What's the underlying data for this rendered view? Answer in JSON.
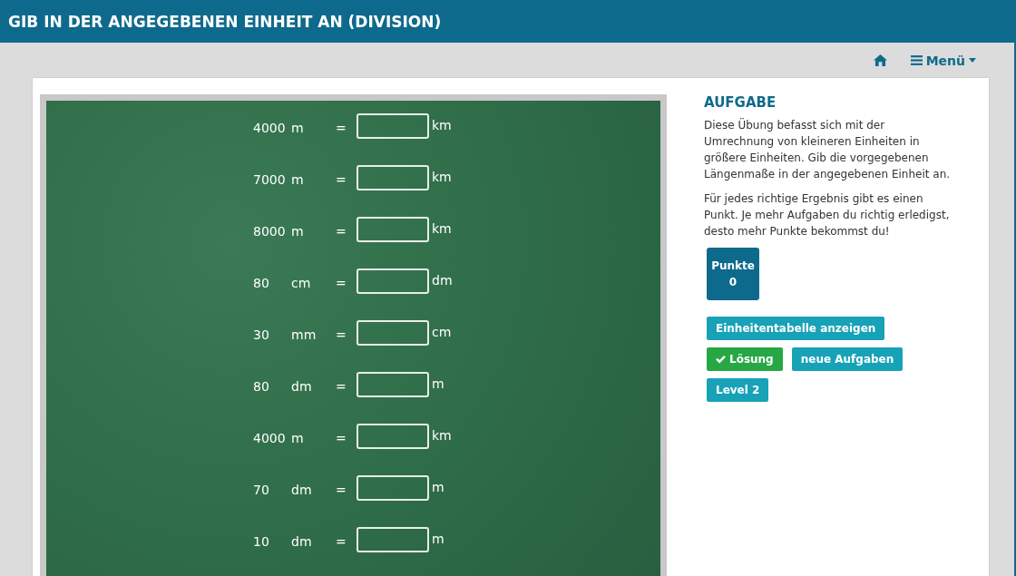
{
  "header": {
    "title": "GIB IN DER ANGEGEBENEN EINHEIT AN (DIVISION)"
  },
  "nav": {
    "menu": "Menü"
  },
  "exercises": [
    {
      "value": "4000",
      "unit": "m",
      "equals": "=",
      "target": "km"
    },
    {
      "value": "7000",
      "unit": "m",
      "equals": "=",
      "target": "km"
    },
    {
      "value": "8000",
      "unit": "m",
      "equals": "=",
      "target": "km"
    },
    {
      "value": "80",
      "unit": "cm",
      "equals": "=",
      "target": "dm"
    },
    {
      "value": "30",
      "unit": "mm",
      "equals": "=",
      "target": "cm"
    },
    {
      "value": "80",
      "unit": "dm",
      "equals": "=",
      "target": "m"
    },
    {
      "value": "4000",
      "unit": "m",
      "equals": "=",
      "target": "km"
    },
    {
      "value": "70",
      "unit": "dm",
      "equals": "=",
      "target": "m"
    },
    {
      "value": "10",
      "unit": "dm",
      "equals": "=",
      "target": "m"
    }
  ],
  "task": {
    "heading": "AUFGABE",
    "paragraphs": [
      "Diese Übung befasst sich mit der Umrechnung von kleineren Einheiten in größere Einheiten. Gib die vorgegebenen Längenmaße in der angegebenen Einheit an.",
      "Für jedes richtige Ergebnis gibt es einen Punkt. Je mehr Aufgaben du richtig erledigst, desto mehr Punkte bekommst du!"
    ]
  },
  "score": {
    "label": "Punkte",
    "value": "0"
  },
  "buttons": [
    {
      "label": "Einheitentabelle anzeigen",
      "kind": "info"
    },
    {
      "label": "Lösung",
      "kind": "success"
    },
    {
      "label": "neue Aufgaben",
      "kind": "info"
    },
    {
      "label": "Level 2",
      "kind": "info"
    }
  ]
}
